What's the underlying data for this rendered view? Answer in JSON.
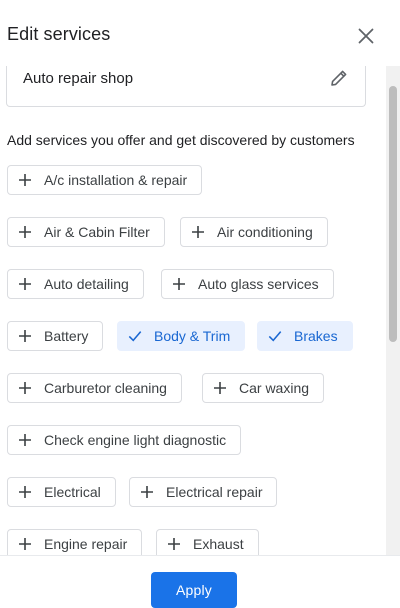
{
  "dialog": {
    "title": "Edit services"
  },
  "category": {
    "value": "Auto repair shop"
  },
  "intro_text": "Add services you offer and get discovered by customers",
  "services": [
    {
      "label": "A/c installation & repair",
      "selected": false
    },
    {
      "label": "Air & Cabin Filter",
      "selected": false
    },
    {
      "label": "Air conditioning",
      "selected": false
    },
    {
      "label": "Auto detailing",
      "selected": false
    },
    {
      "label": "Auto glass services",
      "selected": false
    },
    {
      "label": "Battery",
      "selected": false
    },
    {
      "label": "Body & Trim",
      "selected": true
    },
    {
      "label": "Brakes",
      "selected": true
    },
    {
      "label": "Carburetor cleaning",
      "selected": false
    },
    {
      "label": "Car waxing",
      "selected": false
    },
    {
      "label": "Check engine light diagnostic",
      "selected": false
    },
    {
      "label": "Electrical",
      "selected": false
    },
    {
      "label": "Electrical repair",
      "selected": false
    },
    {
      "label": "Engine repair",
      "selected": false
    },
    {
      "label": "Exhaust",
      "selected": false
    }
  ],
  "footer": {
    "apply_label": "Apply"
  },
  "colors": {
    "accent": "#1a73e8",
    "selected_bg": "#e8f0fe",
    "selected_text": "#1967d2"
  }
}
